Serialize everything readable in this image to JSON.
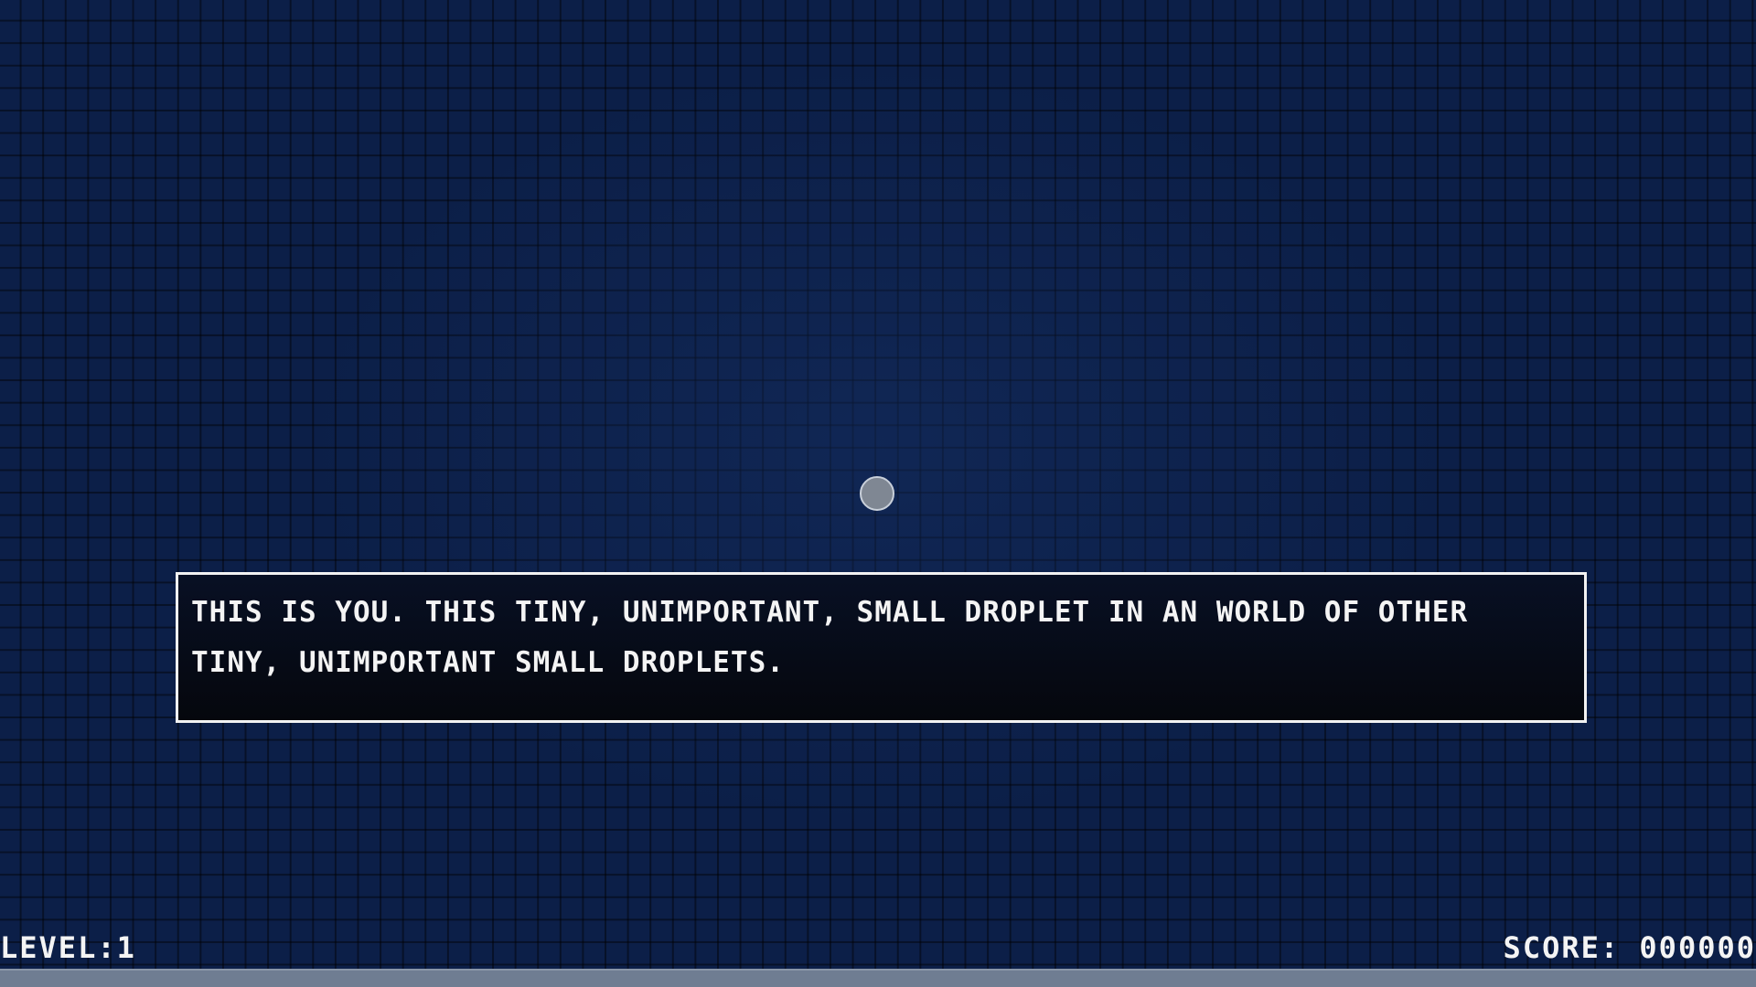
{
  "dialog": {
    "text": "THIS IS YOU. THIS TINY, UNIMPORTANT, SMALL DROPLET IN AN WORLD OF OTHER TINY, UNIMPORTANT SMALL DROPLETS."
  },
  "hud": {
    "level_label": "LEVEL:",
    "level_value": "1",
    "score_label": "SCORE:",
    "score_value": "000000"
  },
  "progress": {
    "fraction": 1.0
  },
  "colors": {
    "background": "#0c1f48",
    "grid_lines": "#000000",
    "player": "#7f8793",
    "dialog_border": "#f2f2f2",
    "text": "#f4f4f4",
    "progress_fill": "#6f7d92"
  }
}
